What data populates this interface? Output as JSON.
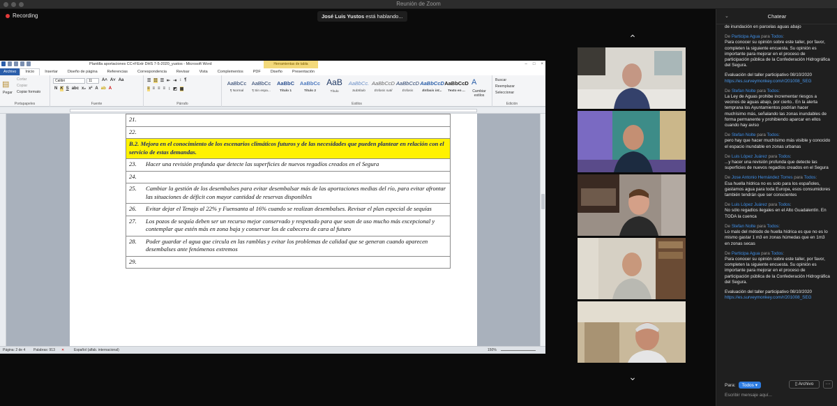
{
  "window": {
    "title": "Reunión de Zoom"
  },
  "recording": {
    "label": "Recording"
  },
  "speaking": {
    "name": "José Luis Yustos",
    "suffix": " está hablando..."
  },
  "word": {
    "title": "Plantilla aportaciones CC+FExtr DHS 7-5-2020_yustos  -  Microsoft Word",
    "context_tab": "Herramientas de tabla",
    "tabs": [
      "Archivo",
      "Inicio",
      "Insertar",
      "Diseño de página",
      "Referencias",
      "Correspondencia",
      "Revisar",
      "Vista",
      "Complementos",
      "PDF",
      "Diseño",
      "Presentación"
    ],
    "ribbon": {
      "paste": "Pegar",
      "cut": "Cortar",
      "copy": "Copiar",
      "format_painter": "Copiar formato",
      "clipboard": "Portapapeles",
      "font_name": "Calibri",
      "font_size": "11",
      "font_group": "Fuente",
      "paragraph_group": "Párrafo",
      "styles_group": "Estilos",
      "editing_group": "Edición",
      "change_styles": "Cambiar estilos",
      "find": "Buscar",
      "replace": "Reemplazar",
      "select": "Seleccionar",
      "styles": [
        {
          "sample": "AaBbCc",
          "name": "¶ Normal"
        },
        {
          "sample": "AaBbCc",
          "name": "¶ Sin espa..."
        },
        {
          "sample": "AaBbC",
          "name": "Título 1"
        },
        {
          "sample": "AaBbCc",
          "name": "Título 2"
        },
        {
          "sample": "AaB",
          "name": "Título"
        },
        {
          "sample": "AaBbCc.",
          "name": "Subtítulo"
        },
        {
          "sample": "AaBbCcD",
          "name": "Énfasis sutil"
        },
        {
          "sample": "AaBbCcD",
          "name": "Énfasis"
        },
        {
          "sample": "AaBbCcD",
          "name": "Énfasis int..."
        },
        {
          "sample": "AaBbCcD",
          "name": "Texto en ..."
        }
      ]
    },
    "rows": [
      {
        "n": "21.",
        "text": ""
      },
      {
        "n": "22.",
        "text": ""
      },
      {
        "n": "",
        "text": "B.2. Mejora en el conocimiento de los escenarios climáticos futuros y de las necesidades que pueden plantear en relación con el servicio de estas demandas.",
        "highlight": true
      },
      {
        "n": "23.",
        "text": "Hacer una revisión profunda que detecte las superficies de nuevos regadíos creados en el Segura"
      },
      {
        "n": "24.",
        "text": ""
      },
      {
        "n": "25.",
        "text": "Cambiar la gestión de los desembalses para evitar desembalsar más de las aportaciones medias del río, para evitar afrontar las situaciones de déficit con mayor cantidad de reservas disponibles"
      },
      {
        "n": "26.",
        "text": "Evitar dejar el Tenajo al 22% y  Fuensanta al 16% cuando se realizan desembalses. Revisar el plan especial de sequías"
      },
      {
        "n": "27.",
        "text": "Los pozos de sequía deben ser un recurso mejor conservado y respetado para que sean de uso mucho más excepcional y contemplar que estén más en zona baja y conservar los de cabecera de cara al futuro"
      },
      {
        "n": "28.",
        "text": "Poder guardar el agua que circula en  las ramblas y evitar los problemas de calidad que se generan cuando  aparecen desembalses ante fenómenos extremos"
      },
      {
        "n": "29.",
        "text": ""
      }
    ],
    "status": {
      "page": "Página: 2 de 4",
      "words": "Palabras: 913",
      "language": "Español (alfab. internacional)",
      "zoom": "150%"
    }
  },
  "chat": {
    "title": "Chatear",
    "partial": "de inundación en parcelas aguas abajo",
    "messages": [
      {
        "from": "Participa Agua",
        "to": "Todos",
        "text": "Para conocer su opinión sobre este taller, por favor, completen la siguiente encuesta. Su opinión es importante para mejorar en el proceso de participación pública de la Confederación Hidrográfica del Segura.",
        "extra": "Evaluación del taller participativo 08/10/2020",
        "link": "https://es.surveymonkey.com/r/201008_SEG"
      },
      {
        "from": "Stefan Nolte",
        "to": "Todos",
        "text": "La Ley de Aguas prohibe incrementar riesgos a vecinos de aguas abajo, por cierto.. En la alerta temprana los Ayuntamientos podrían hacer muchísimo más, señalando las zonas inundables de forma permanente y prohibiendo aparcar en ellos cuando hay aviso"
      },
      {
        "from": "Stefan Nolte",
        "to": "Todos",
        "text": "pero hay que hacer muchísimo más visible y conocido el espacio inundable en zonas urbanas"
      },
      {
        "from": "Luis López Juárez",
        "to": "Todos",
        "text": "...y hacer una revisión profunda que detecte las superficies de nuevos regadíos creados en el Segura"
      },
      {
        "from": "Jose Antonio Hernández Torres",
        "to": "Todos",
        "text": "Esa huella hídrica no es solo para los españoles, gastamos agua para toda Europa, esos consumidores también tendrán que ser conscientes"
      },
      {
        "from": "Luis López Juárez",
        "to": "Todos",
        "text": "No sólo regadíos ilegales en el Alto Guadalentín. En TODA la cuenca"
      },
      {
        "from": "Stefan Nolte",
        "to": "Todos",
        "text": "Lo malo del método de huella hídrica es que no es lo mismo gastar 1 m3 en zonas húmedas que en 1m3 en zonas secas"
      },
      {
        "from": "Participa Agua",
        "to": "Todos",
        "text": "Para conocer su opinión sobre este taller, por favor, completen la siguiente encuesta. Su opinión es importante para mejorar en el proceso de participación pública de la Confederación Hidrográfica del Segura.",
        "extra": "Evaluación del taller participativo 08/10/2020",
        "link": "https://es.surveymonkey.com/r/201008_SEG"
      }
    ],
    "to_label": "Para:",
    "to_value": "Todos",
    "file_button": "Archivo",
    "more": "···",
    "placeholder": "Escribir mensaje aquí..."
  }
}
